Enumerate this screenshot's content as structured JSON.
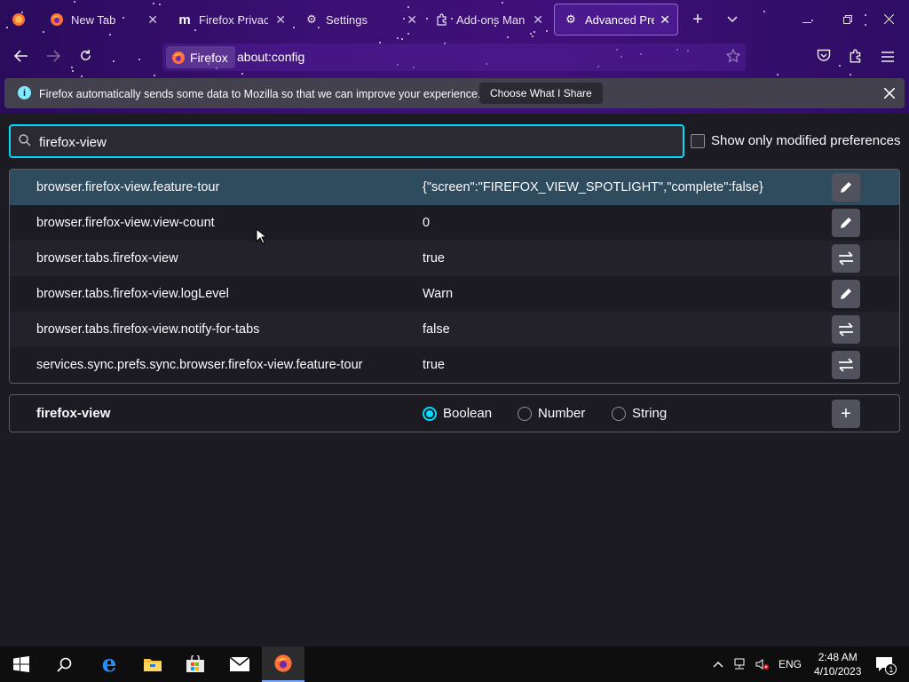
{
  "tabs": [
    {
      "label": "New Tab",
      "icon": "firefox-icon"
    },
    {
      "label": "Firefox Privacy N",
      "icon": "mozilla-icon"
    },
    {
      "label": "Settings",
      "icon": "gear-icon"
    },
    {
      "label": "Add-ons Manag",
      "icon": "puzzle-icon"
    },
    {
      "label": "Advanced Prefe",
      "icon": "gear-icon"
    }
  ],
  "navbar": {
    "identity_label": "Firefox",
    "url": "about:config"
  },
  "notification": {
    "message": "Firefox automatically sends some data to Mozilla so that we can improve your experience.",
    "button": "Choose What I Share"
  },
  "search": {
    "value": "firefox-view"
  },
  "modified_only": {
    "label": "Show only modified preferences",
    "checked": false
  },
  "prefs": [
    {
      "name": "browser.firefox-view.feature-tour",
      "value": "{\"screen\":\"FIREFOX_VIEW_SPOTLIGHT\",\"complete\":false}",
      "action": "edit"
    },
    {
      "name": "browser.firefox-view.view-count",
      "value": "0",
      "action": "edit"
    },
    {
      "name": "browser.tabs.firefox-view",
      "value": "true",
      "action": "toggle"
    },
    {
      "name": "browser.tabs.firefox-view.logLevel",
      "value": "Warn",
      "action": "edit"
    },
    {
      "name": "browser.tabs.firefox-view.notify-for-tabs",
      "value": "false",
      "action": "toggle"
    },
    {
      "name": "services.sync.prefs.sync.browser.firefox-view.feature-tour",
      "value": "true",
      "action": "toggle"
    }
  ],
  "new_pref": {
    "name": "firefox-view",
    "types": [
      "Boolean",
      "Number",
      "String"
    ],
    "selected": "Boolean"
  },
  "taskbar": {
    "lang": "ENG",
    "time": "2:48 AM",
    "date": "4/10/2023",
    "notification_count": "1"
  },
  "colors": {
    "accent": "#00ddff",
    "theme": "#3b0f74",
    "highlight_row": "#2f4b5e"
  }
}
